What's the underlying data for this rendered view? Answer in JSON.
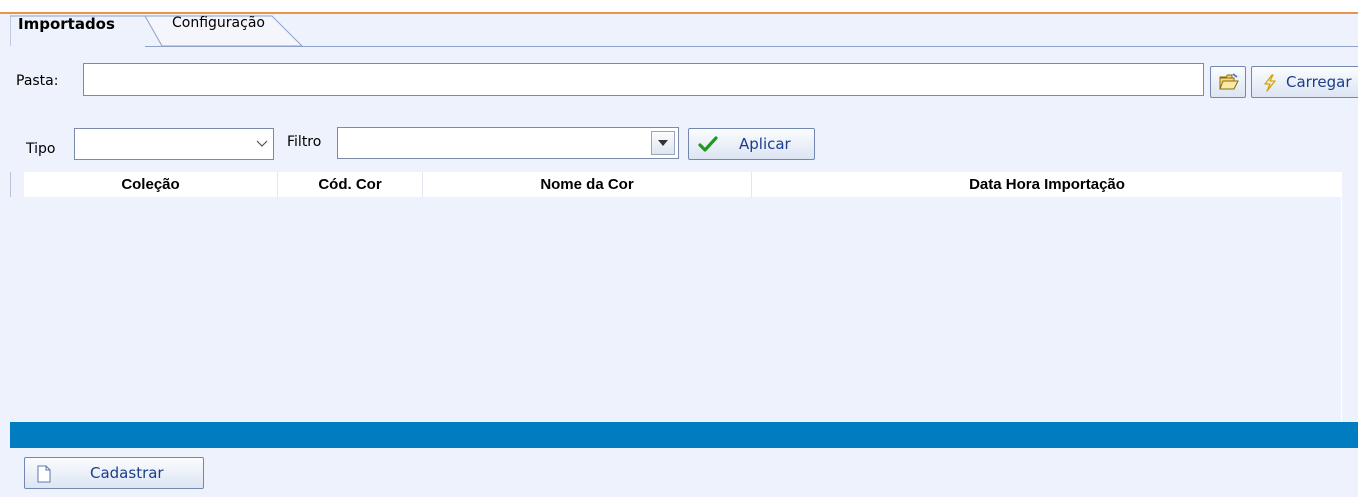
{
  "tabs": {
    "active": "Importados",
    "second": "Configuração"
  },
  "pasta": {
    "label": "Pasta:",
    "value": "",
    "carregar_label": "Carregar"
  },
  "filters": {
    "tipo_label": "Tipo",
    "tipo_value": "",
    "filtro_label": "Filtro",
    "filtro_value": "",
    "aplicar_label": "Aplicar"
  },
  "grid": {
    "columns": [
      "Coleção",
      "Cód. Cor",
      "Nome da Cor",
      "Data Hora Importação"
    ],
    "rows": []
  },
  "footer": {
    "cadastrar_label": "Cadastrar"
  },
  "colors": {
    "accent_orange": "#e8944a",
    "status_bar": "#007dc1",
    "background": "#eef2fc"
  },
  "icons": {
    "folder": "folder-open-icon",
    "carregar": "lightning-icon",
    "aplicar": "checkmark-icon",
    "cadastrar": "document-icon"
  }
}
